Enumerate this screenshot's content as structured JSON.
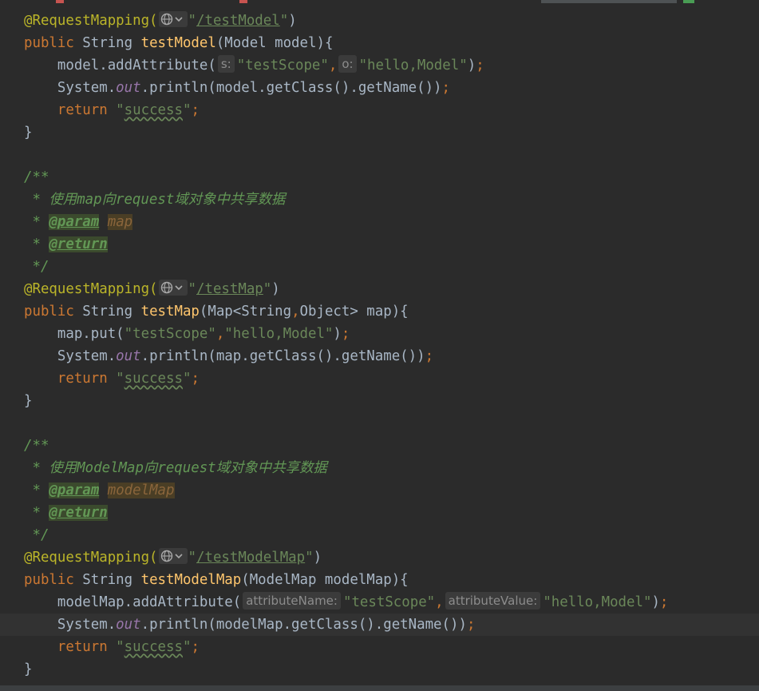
{
  "editor": {
    "lines": [
      {
        "tokens": [
          [
            "ann",
            "@RequestMapping("
          ],
          [
            "globe",
            ""
          ],
          [
            "str",
            "\""
          ],
          [
            "strlink",
            "/testModel"
          ],
          [
            "str",
            "\""
          ],
          [
            "plain",
            ")"
          ]
        ]
      },
      {
        "tokens": [
          [
            "kw",
            "public "
          ],
          [
            "plain",
            "String "
          ],
          [
            "fn",
            "testModel"
          ],
          [
            "plain",
            "(Model model){"
          ]
        ]
      },
      {
        "tokens": [
          [
            "plain",
            "    model.addAttribute("
          ],
          [
            "hint",
            "s:"
          ],
          [
            "str",
            "\"testScope\""
          ],
          [
            "kw",
            ","
          ],
          [
            "hint",
            "o:"
          ],
          [
            "str",
            "\"hello,Model\""
          ],
          [
            "plain",
            ")"
          ],
          [
            "semi",
            ";"
          ]
        ]
      },
      {
        "tokens": [
          [
            "plain",
            "    System."
          ],
          [
            "field",
            "out"
          ],
          [
            "plain",
            ".println(model.getClass().getName())"
          ],
          [
            "semi",
            ";"
          ]
        ]
      },
      {
        "tokens": [
          [
            "kw",
            "    return "
          ],
          [
            "str",
            "\""
          ],
          [
            "strtypo",
            "success"
          ],
          [
            "str",
            "\""
          ],
          [
            "semi",
            ";"
          ]
        ]
      },
      {
        "tokens": [
          [
            "plain",
            "}"
          ]
        ]
      },
      {
        "tokens": []
      },
      {
        "tokens": [
          [
            "doc",
            "/**"
          ]
        ]
      },
      {
        "tokens": [
          [
            "doc",
            " * 使用map向request域对象中共享数据"
          ]
        ]
      },
      {
        "tokens": [
          [
            "doc",
            " * "
          ],
          [
            "doctag",
            "@param"
          ],
          [
            "doc",
            " "
          ],
          [
            "docparam",
            "map"
          ]
        ]
      },
      {
        "tokens": [
          [
            "doc",
            " * "
          ],
          [
            "doctag",
            "@return"
          ]
        ]
      },
      {
        "tokens": [
          [
            "doc",
            " */"
          ]
        ]
      },
      {
        "tokens": [
          [
            "ann",
            "@RequestMapping("
          ],
          [
            "globe",
            ""
          ],
          [
            "str",
            "\""
          ],
          [
            "strlink",
            "/testMap"
          ],
          [
            "str",
            "\""
          ],
          [
            "plain",
            ")"
          ]
        ]
      },
      {
        "tokens": [
          [
            "kw",
            "public "
          ],
          [
            "plain",
            "String "
          ],
          [
            "fn",
            "testMap"
          ],
          [
            "plain",
            "(Map<String"
          ],
          [
            "kw",
            ","
          ],
          [
            "plain",
            "Object> map){"
          ]
        ]
      },
      {
        "tokens": [
          [
            "plain",
            "    map.put("
          ],
          [
            "str",
            "\"testScope\""
          ],
          [
            "kw",
            ","
          ],
          [
            "str",
            "\"hello,Model\""
          ],
          [
            "plain",
            ")"
          ],
          [
            "semi",
            ";"
          ]
        ]
      },
      {
        "tokens": [
          [
            "plain",
            "    System."
          ],
          [
            "field",
            "out"
          ],
          [
            "plain",
            ".println(map.getClass().getName())"
          ],
          [
            "semi",
            ";"
          ]
        ]
      },
      {
        "tokens": [
          [
            "kw",
            "    return "
          ],
          [
            "str",
            "\""
          ],
          [
            "strtypo",
            "success"
          ],
          [
            "str",
            "\""
          ],
          [
            "semi",
            ";"
          ]
        ]
      },
      {
        "tokens": [
          [
            "plain",
            "}"
          ]
        ]
      },
      {
        "tokens": []
      },
      {
        "tokens": [
          [
            "doc",
            "/**"
          ]
        ]
      },
      {
        "tokens": [
          [
            "doc",
            " * 使用ModelMap向request域对象中共享数据"
          ]
        ]
      },
      {
        "tokens": [
          [
            "doc",
            " * "
          ],
          [
            "doctag",
            "@param"
          ],
          [
            "doc",
            " "
          ],
          [
            "docparam",
            "modelMap"
          ]
        ]
      },
      {
        "tokens": [
          [
            "doc",
            " * "
          ],
          [
            "doctag",
            "@return"
          ]
        ]
      },
      {
        "tokens": [
          [
            "doc",
            " */"
          ]
        ]
      },
      {
        "tokens": [
          [
            "ann",
            "@RequestMapping("
          ],
          [
            "globe",
            ""
          ],
          [
            "str",
            "\""
          ],
          [
            "strlink",
            "/testModelMap"
          ],
          [
            "str",
            "\""
          ],
          [
            "plain",
            ")"
          ]
        ]
      },
      {
        "tokens": [
          [
            "kw",
            "public "
          ],
          [
            "plain",
            "String "
          ],
          [
            "fn",
            "testModelMap"
          ],
          [
            "plain",
            "(ModelMap modelMap){"
          ]
        ]
      },
      {
        "tokens": [
          [
            "plain",
            "    modelMap.addAttribute("
          ],
          [
            "hint",
            "attributeName:"
          ],
          [
            "str",
            "\"testScope\""
          ],
          [
            "kw",
            ","
          ],
          [
            "hint",
            "attributeValue:"
          ],
          [
            "str",
            "\"hello,Model\""
          ],
          [
            "plain",
            ")"
          ],
          [
            "semi",
            ";"
          ]
        ]
      },
      {
        "tokens": [
          [
            "plain",
            "    System."
          ],
          [
            "field",
            "out"
          ],
          [
            "plain",
            ".println(modelMap.getClass().getName())"
          ],
          [
            "semi",
            ";"
          ]
        ],
        "current": true
      },
      {
        "tokens": [
          [
            "kw",
            "    return "
          ],
          [
            "str",
            "\""
          ],
          [
            "strtypo",
            "success"
          ],
          [
            "str",
            "\""
          ],
          [
            "semi",
            ";"
          ]
        ]
      },
      {
        "tokens": [
          [
            "plain",
            "}"
          ]
        ]
      }
    ]
  },
  "icons": {
    "globe": "globe-icon",
    "chevron": "chevron-down-icon"
  },
  "colors": {
    "background": "#2b2b2b",
    "annotation": "#bbb529",
    "keyword": "#cc7832",
    "function": "#ffc66d",
    "string": "#6a8759",
    "field": "#9876aa",
    "doc": "#629755",
    "text": "#a9b7c6",
    "current_line": "#323232"
  }
}
